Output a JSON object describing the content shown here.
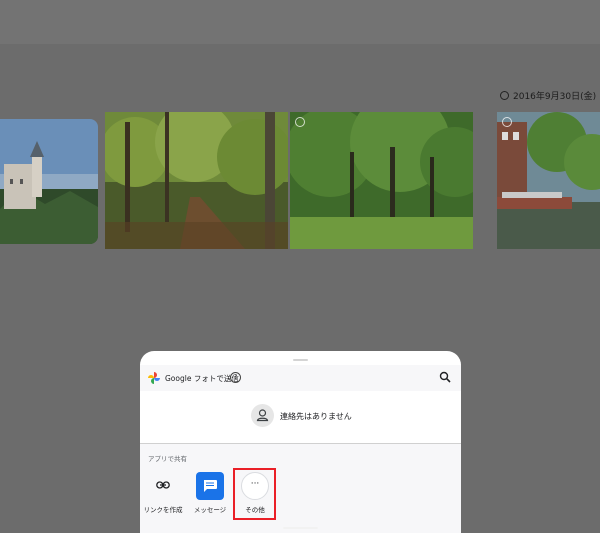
{
  "colors": {
    "scrim": "#6c6c6c",
    "sheet_bg": "#ffffff",
    "sheet_header_bg": "#f7f7f9",
    "highlight_border": "#ea1f27",
    "messages_blue": "#1a73e8"
  },
  "gallery": {
    "date_label": "2016年9月30日(金)",
    "photos": [
      {
        "subject": "castle-on-hill"
      },
      {
        "subject": "forest-path-autumn"
      },
      {
        "subject": "park-trees-lawn"
      },
      {
        "subject": "canal-houses-boat"
      }
    ]
  },
  "share_sheet": {
    "title": "Google フォトで送信",
    "help_icon": "help-circle-icon",
    "search_icon": "search-icon",
    "contacts_empty_text": "連絡先はありません",
    "apps_section_label": "アプリで共有",
    "apps": [
      {
        "label": "リンクを作成",
        "icon": "link-icon"
      },
      {
        "label": "メッセージ",
        "icon": "messages-icon"
      },
      {
        "label": "その他",
        "icon": "more-horiz-icon"
      }
    ]
  }
}
